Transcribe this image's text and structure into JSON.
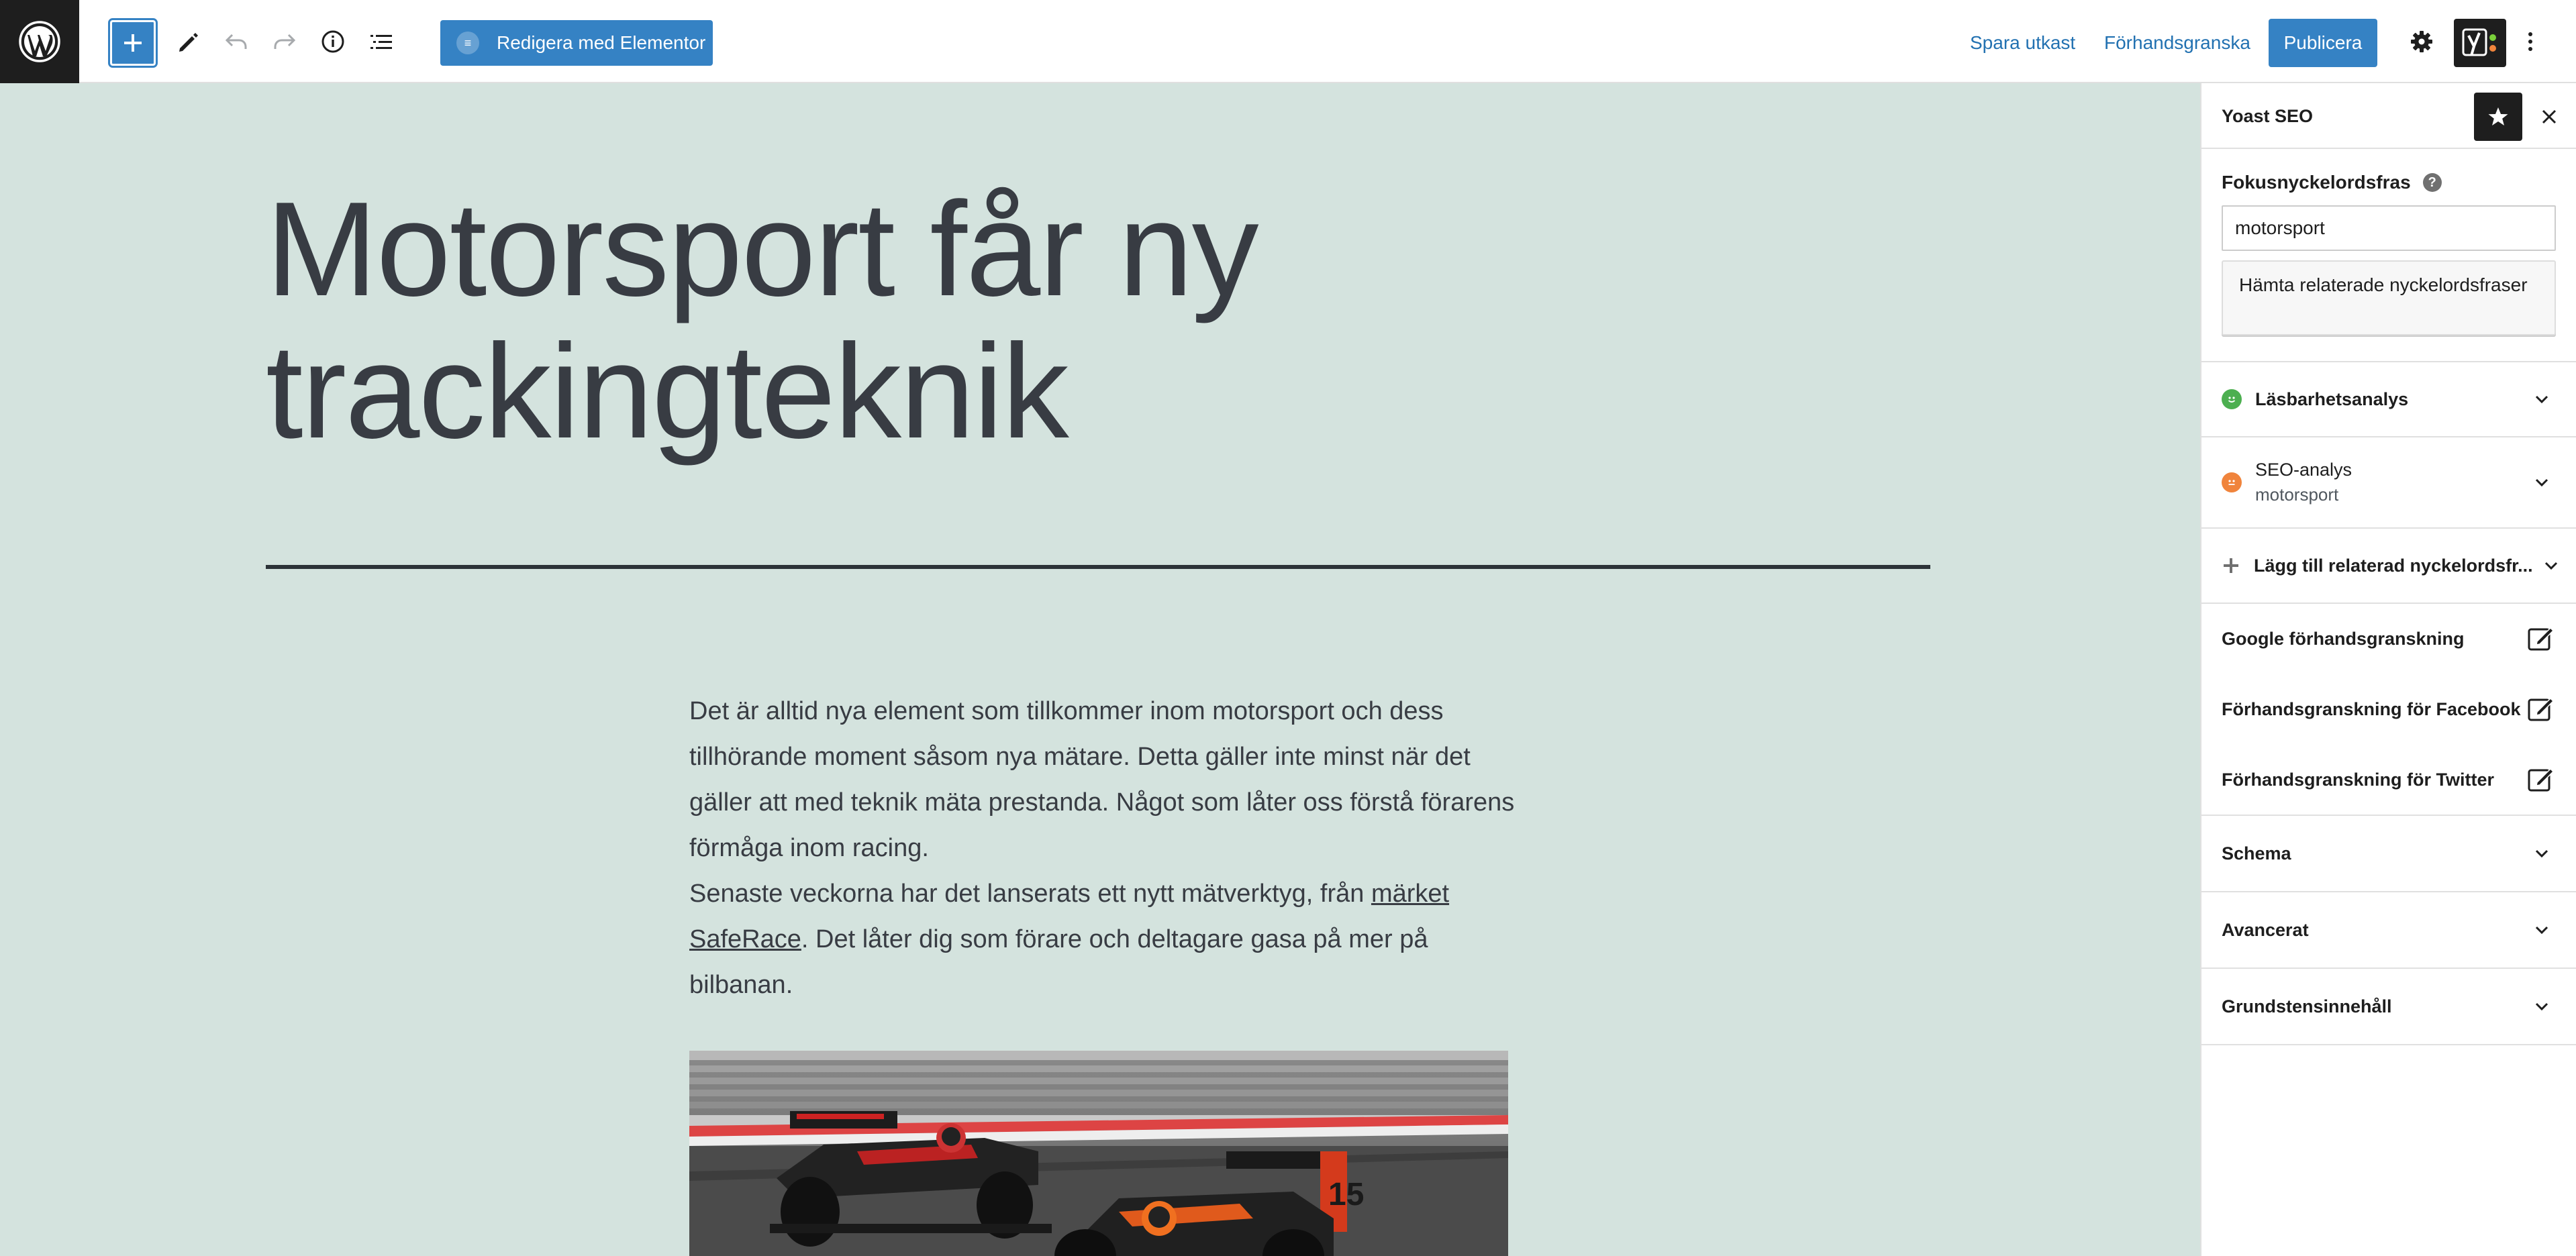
{
  "toolbar": {
    "elementor_label": "Redigera med Elementor",
    "save_draft": "Spara utkast",
    "preview": "Förhandsgranska",
    "publish": "Publicera"
  },
  "post": {
    "title": "Motorsport får ny trackingteknik",
    "paragraph1": "Det är alltid nya element som tillkommer inom motorsport och dess tillhörande moment såsom nya mätare. Detta gäller inte minst när det gäller att med teknik mäta prestanda. Något som låter oss förstå förarens förmåga inom racing.",
    "paragraph2_before": "Senaste veckorna har det lanserats ett nytt mätverktyg, från ",
    "paragraph2_link": "märket SafeRace",
    "paragraph2_after": ". Det låter dig som förare och deltagare gasa på mer på bilbanan."
  },
  "sidebar": {
    "title": "Yoast SEO",
    "focus_label": "Fokusnyckelordsfras",
    "focus_value": "motorsport",
    "related_button": "Hämta relaterade nyckelordsfraser",
    "readability": "Läsbarhetsanalys",
    "seo_analysis": "SEO-analys",
    "seo_keyword": "motorsport",
    "add_related": "Lägg till relaterad nyckelordsfr...",
    "google_preview": "Google förhandsgranskning",
    "facebook_preview": "Förhandsgranskning för Facebook",
    "twitter_preview": "Förhandsgranskning för Twitter",
    "schema": "Schema",
    "advanced": "Avancerat",
    "cornerstone": "Grundstensinnehåll"
  },
  "colors": {
    "accent": "#3582c4",
    "canvas_bg": "#d4e3de",
    "readability_status": "#4caf50",
    "seo_status": "#f0843c"
  }
}
